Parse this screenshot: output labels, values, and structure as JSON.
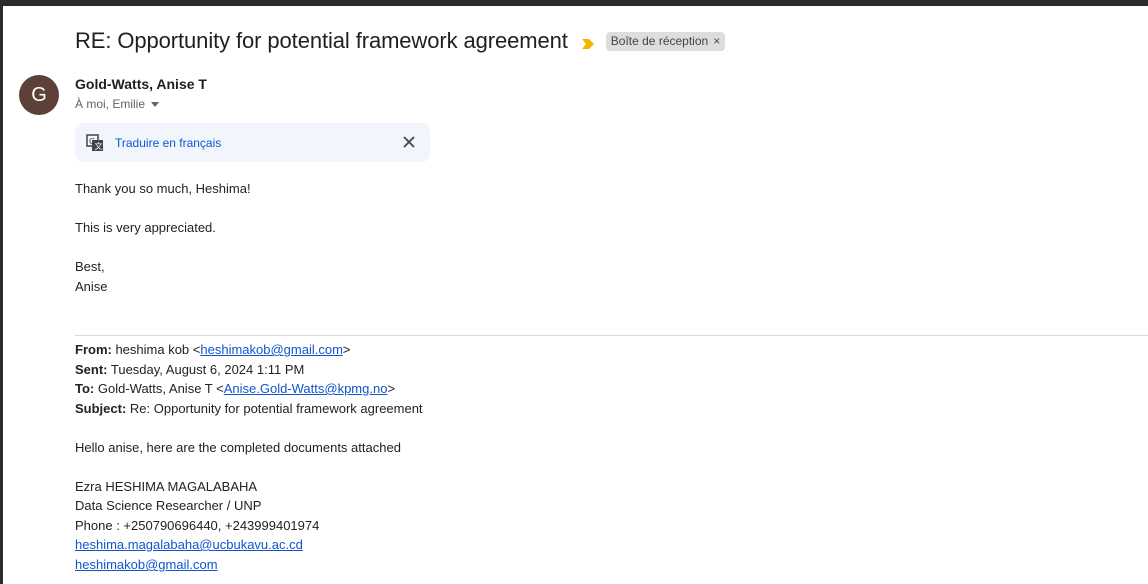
{
  "email": {
    "subject": "RE: Opportunity for potential framework agreement",
    "label": "Boîte de réception",
    "label_close": "×",
    "colors": {
      "importance": "#f4b400",
      "avatar_bg": "#5d4037",
      "link": "#1155cc",
      "translate_link": "#0b57d0"
    },
    "sender": {
      "avatar_letter": "G",
      "name": "Gold-Watts, Anise T",
      "recipients": "À moi, Emilie"
    },
    "translate": {
      "label": "Traduire en français"
    },
    "body": {
      "line1": "Thank you so much, Heshima!",
      "line2": "This is very appreciated.",
      "line3": "Best,",
      "line4": "Anise"
    },
    "quoted": {
      "from_label": "From:",
      "from_name": " heshima kob <",
      "from_email": "heshimakob@gmail.com",
      "from_end": ">",
      "sent_label": "Sent:",
      "sent_value": " Tuesday, August 6, 2024 1:11 PM",
      "to_label": "To:",
      "to_name": " Gold-Watts, Anise T <",
      "to_email": "Anise.Gold-Watts@kpmg.no",
      "to_end": ">",
      "subject_label": "Subject:",
      "subject_value": " Re: Opportunity for potential framework agreement",
      "greeting": "Hello anise, here are the completed documents attached",
      "sig_name": "Ezra HESHIMA MAGALABAHA",
      "sig_title": "Data Science Researcher  / UNP",
      "sig_phone": "Phone : +250790696440, +243999401974",
      "sig_email1": "heshima.magalabaha@ucbukavu.ac.cd",
      "sig_email2": "heshimakob@gmail.com"
    }
  }
}
